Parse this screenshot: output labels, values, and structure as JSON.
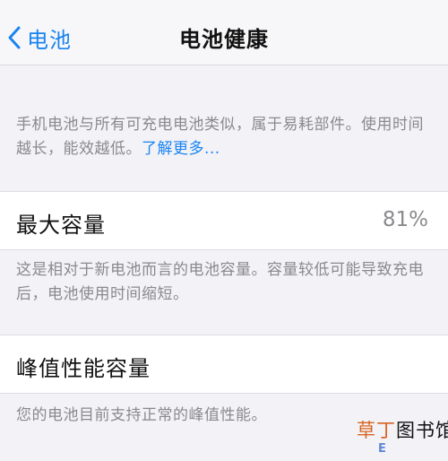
{
  "nav": {
    "back_label": "电池",
    "title": "电池健康"
  },
  "intro": {
    "text": "手机电池与所有可充电电池类似，属于易耗部件。使用时间越长，能效越低。",
    "link": "了解更多..."
  },
  "max_capacity": {
    "label": "最大容量",
    "value": "81%",
    "footnote": "这是相对于新电池而言的电池容量。容量较低可能导致充电后，电池使用时间缩短。"
  },
  "peak_performance": {
    "label": "峰值性能容量",
    "footnote": "您的电池目前支持正常的峰值性能。"
  },
  "watermark": {
    "part_a": "草丁",
    "part_b": "图书馆"
  },
  "colors": {
    "accent": "#1a84f0",
    "background": "#f2f2f7",
    "secondary_text": "#8a8a8e"
  }
}
